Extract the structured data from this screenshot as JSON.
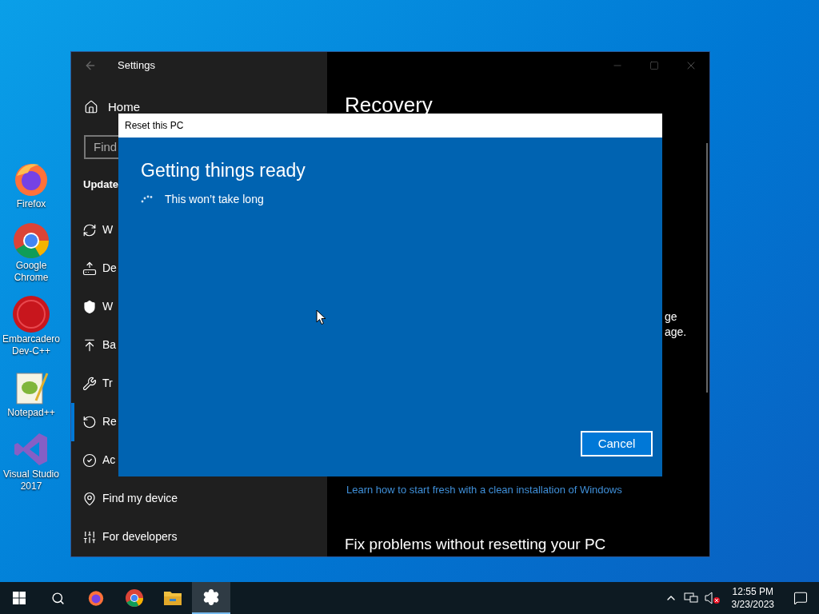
{
  "desktop_icons": [
    {
      "kind": "firefox",
      "label": "Firefox"
    },
    {
      "kind": "chrome",
      "label": "Google Chrome"
    },
    {
      "kind": "devcpp",
      "label": "Embarcadero Dev-C++"
    },
    {
      "kind": "notepad",
      "label": "Notepad++"
    },
    {
      "kind": "vstudio",
      "label": "Visual Studio 2017"
    }
  ],
  "settings_window": {
    "title": "Settings",
    "home": "Home",
    "search": {
      "placeholder": "Find"
    },
    "section": "Update",
    "nav": [
      {
        "kind": "sync",
        "label": "W",
        "selected": false
      },
      {
        "kind": "delivery",
        "label": "De",
        "selected": false
      },
      {
        "kind": "shield",
        "label": "W",
        "selected": false
      },
      {
        "kind": "backup",
        "label": "Ba",
        "selected": false
      },
      {
        "kind": "wrench",
        "label": "Tr",
        "selected": false
      },
      {
        "kind": "recovery",
        "label": "Re",
        "selected": true
      },
      {
        "kind": "check",
        "label": "Ac",
        "selected": false
      },
      {
        "kind": "find",
        "label": "Find my device",
        "selected": false
      },
      {
        "kind": "developers",
        "label": "For developers",
        "selected": false
      }
    ],
    "content": {
      "heading": "Recovery",
      "fragments": [
        "ge",
        "age."
      ],
      "link": "Learn how to start fresh with a clean installation of Windows",
      "subheading": "Fix problems without resetting your PC"
    }
  },
  "dialog": {
    "title": "Reset this PC",
    "heading": "Getting things ready",
    "status": "This won’t take long",
    "button": "Cancel"
  },
  "taskbar": {
    "apps": [
      {
        "kind": "firefox",
        "active": false
      },
      {
        "kind": "chrome",
        "active": false
      },
      {
        "kind": "explorer",
        "active": false
      },
      {
        "kind": "settings",
        "active": true
      }
    ],
    "time": "12:55 PM",
    "date": "3/23/2023"
  }
}
